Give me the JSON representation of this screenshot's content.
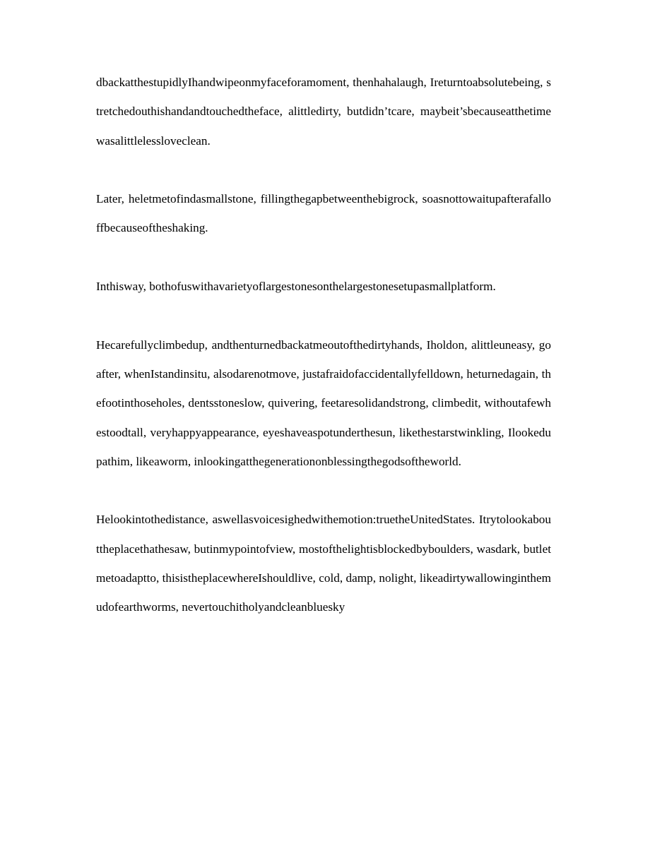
{
  "document": {
    "page_background": "#ffffff",
    "text_color": "#000000",
    "paragraphs": [
      {
        "id": "p1",
        "text": "dbackatthestupidlyIhandwipeonmyfaceforamoment, thenhahalaugh, Ireturntoabsolutebeing, stretchedouthishandandtouchedtheface, alittledirty, butdidn’tcare, maybeit’sbecauseatthetimewasalittlelessloveclean."
      },
      {
        "id": "p2",
        "text": "Later, heletmetofindasmallstone, fillingthegapbetweenthebigrock, soasnottowaitupafterafalloffbecauseoftheshaking."
      },
      {
        "id": "p3",
        "text": "Inthisway, bothofuswithavarietyoflargestonesonthelargestonesetupasmallplatform."
      },
      {
        "id": "p4",
        "text": "Hecarefullyclimbedup, andthenturnedbackatmeoutofthedirtyhands, Iholdon, alittleuneasy, goafter, whenIstandinsitu, alsodarenotmove, justafraidofaccidentallyfelldown, heturnedagain, thefootinthoseholes, dentsstoneslow, quivering, feetaresolidandstrong, climbedit, withoutafewhestoodtall, veryhappyappearance, eyeshaveaspotunderthesun, likethestarstwinkling, Ilookedupathim, likeaworm, inlookingatthegenerationonblessingthegodsoftheworld."
      },
      {
        "id": "p5",
        "text": "Helookintothedistance, aswellasvoicesighedwithemotion:truetheUnitedStates. Itrytolookabouttheplacethathesaw, butinmypointofview, mostofthelightisblockedbyboulders, wasdark, butletmetoadaptto, thisistheplacewhereIshouldlive, cold, damp, nolight, likeadirtywallowinginthemudofearthworms, nevertouchitholyandcleanbluesky"
      }
    ]
  }
}
